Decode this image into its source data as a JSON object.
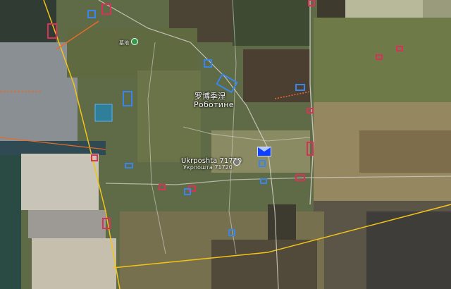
{
  "map": {
    "labels": {
      "town_cn": "罗博季涅",
      "town_cyr": "Роботине",
      "post_office": "Ukrposhta 71720",
      "post_office_sub": "Укрпошта 71720",
      "small_place": "墓地"
    },
    "colors": {
      "boundary": "#f2c418",
      "road": "#d9d7cf",
      "marker_red": "#d8325a",
      "marker_blue": "#3a86e8",
      "selected": "#1040ff"
    },
    "icons": [
      "park-icon",
      "post-office-icon",
      "selected-marker-icon"
    ]
  }
}
